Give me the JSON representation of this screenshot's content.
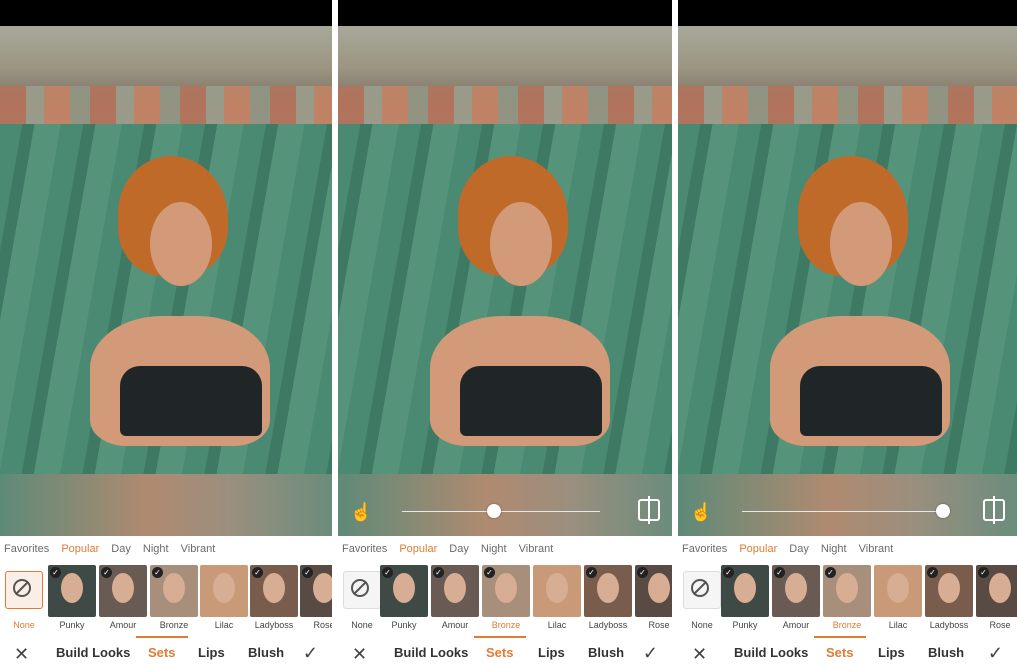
{
  "categories": [
    "Favorites",
    "Popular",
    "Day",
    "Night",
    "Vibrant"
  ],
  "active_category": "Popular",
  "looks": [
    "None",
    "Punky",
    "Amour",
    "Bronze",
    "Lilac",
    "Ladyboss",
    "Rose"
  ],
  "toolbar": {
    "build_looks": "Build Looks",
    "sets": "Sets",
    "lips": "Lips",
    "blush": "Blush"
  },
  "icons": {
    "close": "close-icon",
    "confirm": "checkmark-icon",
    "hand": "hand-touch-icon",
    "compare": "compare-icon",
    "none": "none-icon"
  },
  "panels": [
    {
      "selected_look": "None",
      "slider_visible": false
    },
    {
      "selected_look": "Bronze",
      "slider_visible": true,
      "intensity": 0.5
    },
    {
      "selected_look": "Bronze",
      "slider_visible": true,
      "intensity": 1.0
    }
  ],
  "colors": {
    "accent": "#e07b34"
  }
}
